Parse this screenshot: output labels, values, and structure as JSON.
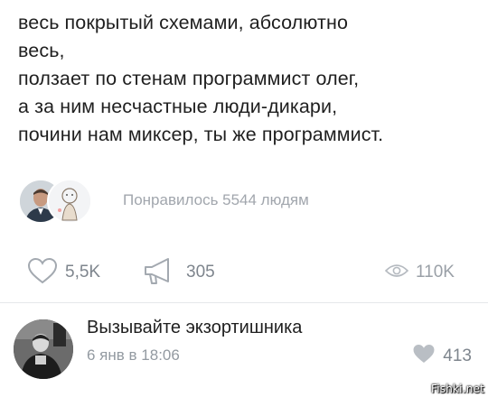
{
  "post": {
    "lines": [
      "весь покрытый схемами, абсолютно",
      "весь,",
      "ползает по стенам программист олег,",
      "а за ним несчастные люди-дикари,",
      "почини нам миксер, ты же программист."
    ]
  },
  "likers": {
    "text": "Понравилось 5544 людям"
  },
  "actions": {
    "likes": "5,5K",
    "shares": "305",
    "views": "110K"
  },
  "comment": {
    "author": "Вызывайте экзортишника",
    "date": "6 янв в 18:06",
    "likes": "413"
  },
  "watermark": "Fishki.net",
  "icons": {
    "like": "heart-outline-icon",
    "share": "megaphone-icon",
    "views": "eye-icon",
    "comment_like": "heart-filled-icon"
  },
  "colors": {
    "text": "#1f1f1f",
    "muted": "#a1a6ad",
    "icon": "#9aa0a7",
    "background": "#ffffff"
  }
}
